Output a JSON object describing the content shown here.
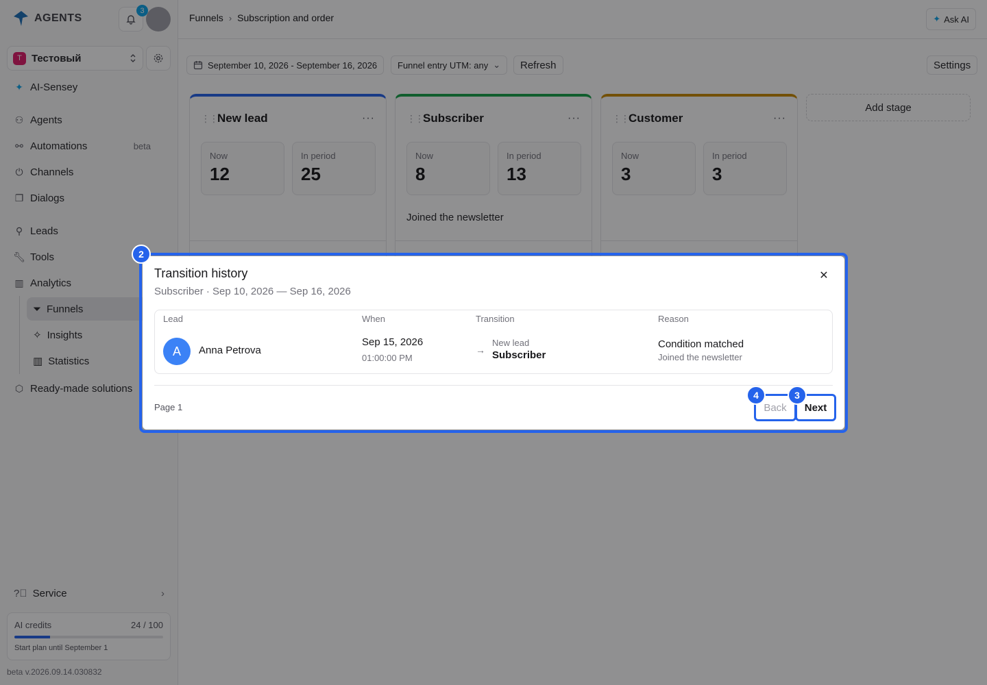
{
  "app": {
    "logo_text": "AGENTS",
    "notifications_count": "3"
  },
  "workspace": {
    "badge": "T",
    "name": "Тестовый"
  },
  "sidebar": {
    "items": [
      {
        "label": "AI-Sensey",
        "icon": "sparkle-icon"
      },
      {
        "label": "Agents",
        "icon": "agents-icon"
      },
      {
        "label": "Automations",
        "icon": "automations-icon",
        "badge": "beta"
      },
      {
        "label": "Channels",
        "icon": "channels-icon"
      },
      {
        "label": "Dialogs",
        "icon": "dialogs-icon"
      },
      {
        "label": "Leads",
        "icon": "user-icon"
      },
      {
        "label": "Tools",
        "icon": "wrench-icon"
      },
      {
        "label": "Analytics",
        "icon": "bar-chart-icon"
      },
      {
        "label": "Ready-made solutions",
        "icon": "package-icon"
      }
    ],
    "analytics_sub": [
      {
        "label": "Funnels",
        "icon": "filter-icon",
        "active": true
      },
      {
        "label": "Insights",
        "icon": "sparkle-icon"
      },
      {
        "label": "Statistics",
        "icon": "bar-chart-icon"
      }
    ],
    "service_label": "Service",
    "credits": {
      "label": "AI credits",
      "value": "24 / 100",
      "fraction": 0.24,
      "plan": "Start plan until September 1"
    },
    "version": "beta v.2026.09.14.030832"
  },
  "header": {
    "breadcrumbs": [
      "Funnels",
      "Subscription and order"
    ],
    "ask_ai": "Ask AI"
  },
  "toolbar": {
    "date_range": "September 10, 2026 - September 16, 2026",
    "utm_filter": "Funnel entry UTM: any",
    "refresh": "Refresh",
    "settings": "Settings"
  },
  "stages": [
    {
      "title": "New lead",
      "color": "#2563eb",
      "now_label": "Now",
      "now": "12",
      "period_label": "In period",
      "period": "25",
      "description": ""
    },
    {
      "title": "Subscriber",
      "color": "#16a34a",
      "now_label": "Now",
      "now": "8",
      "period_label": "In period",
      "period": "13",
      "description": "Joined the newsletter"
    },
    {
      "title": "Customer",
      "color": "#ca8a04",
      "now_label": "Now",
      "now": "3",
      "period_label": "In period",
      "period": "3",
      "description": ""
    }
  ],
  "add_stage": "Add stage",
  "modal": {
    "title": "Transition history",
    "subtitle": "Subscriber · Sep 10, 2026 — Sep 16, 2026",
    "columns": [
      "Lead",
      "When",
      "Transition",
      "Reason"
    ],
    "rows": [
      {
        "avatar": "A",
        "lead": "Anna Petrova",
        "date": "Sep 15, 2026",
        "time": "01:00:00 PM",
        "from": "New lead",
        "to": "Subscriber",
        "reason": "Condition matched",
        "reason_detail": "Joined the newsletter"
      }
    ],
    "page_label": "Page 1",
    "back": "Back",
    "next": "Next"
  },
  "markers": [
    "2",
    "3",
    "4"
  ]
}
